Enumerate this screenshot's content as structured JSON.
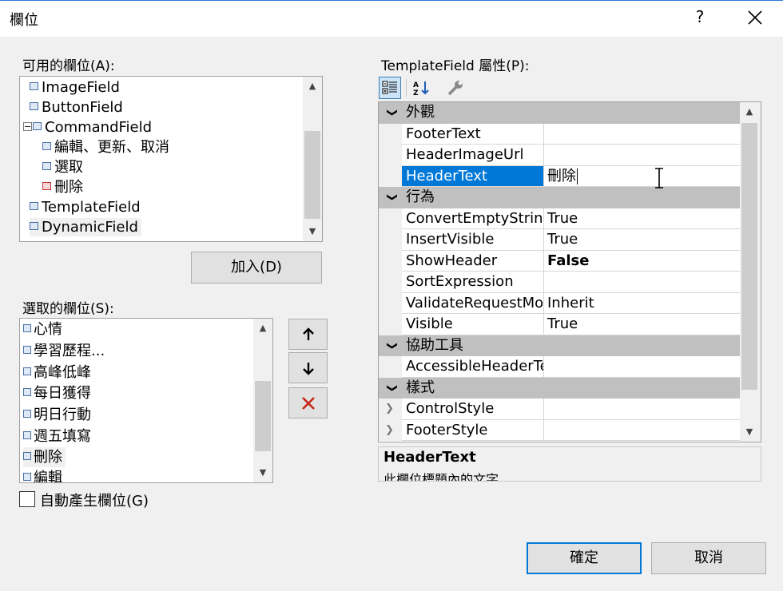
{
  "window": {
    "title": "欄位",
    "help": "?"
  },
  "available": {
    "label": "可用的欄位(A):",
    "items": [
      "ImageField",
      "ButtonField",
      "CommandField",
      "編輯、更新、取消",
      "選取",
      "刪除",
      "TemplateField",
      "DynamicField"
    ],
    "add_button": "加入(D)"
  },
  "selected": {
    "label": "選取的欄位(S):",
    "items": [
      "心情",
      "學習歷程...",
      "高峰低峰",
      "每日獲得",
      "明日行動",
      "週五填寫",
      "刪除",
      "編輯"
    ]
  },
  "autogen": {
    "label": "自動產生欄位(G)",
    "checked": false
  },
  "props": {
    "label": "TemplateField 屬性(P):",
    "categories": {
      "appearance": "外觀",
      "behavior": "行為",
      "accessibility": "協助工具",
      "styles": "樣式"
    },
    "rows": {
      "footer_text": {
        "name": "FooterText",
        "value": ""
      },
      "header_image_url": {
        "name": "HeaderImageUrl",
        "value": ""
      },
      "header_text": {
        "name": "HeaderText",
        "value": "刪除"
      },
      "convert_empty": {
        "name": "ConvertEmptyString",
        "value": "True"
      },
      "insert_visible": {
        "name": "InsertVisible",
        "value": "True"
      },
      "show_header": {
        "name": "ShowHeader",
        "value": "False"
      },
      "sort_expression": {
        "name": "SortExpression",
        "value": ""
      },
      "validate_request": {
        "name": "ValidateRequestMode",
        "value": "Inherit"
      },
      "visible": {
        "name": "Visible",
        "value": "True"
      },
      "accessible_header": {
        "name": "AccessibleHeaderText",
        "value": ""
      },
      "control_style": {
        "name": "ControlStyle",
        "value": ""
      },
      "footer_style": {
        "name": "FooterStyle",
        "value": ""
      }
    },
    "description": {
      "title": "HeaderText",
      "text": "此欄位標題內的文字。"
    }
  },
  "buttons": {
    "ok": "確定",
    "cancel": "取消"
  }
}
